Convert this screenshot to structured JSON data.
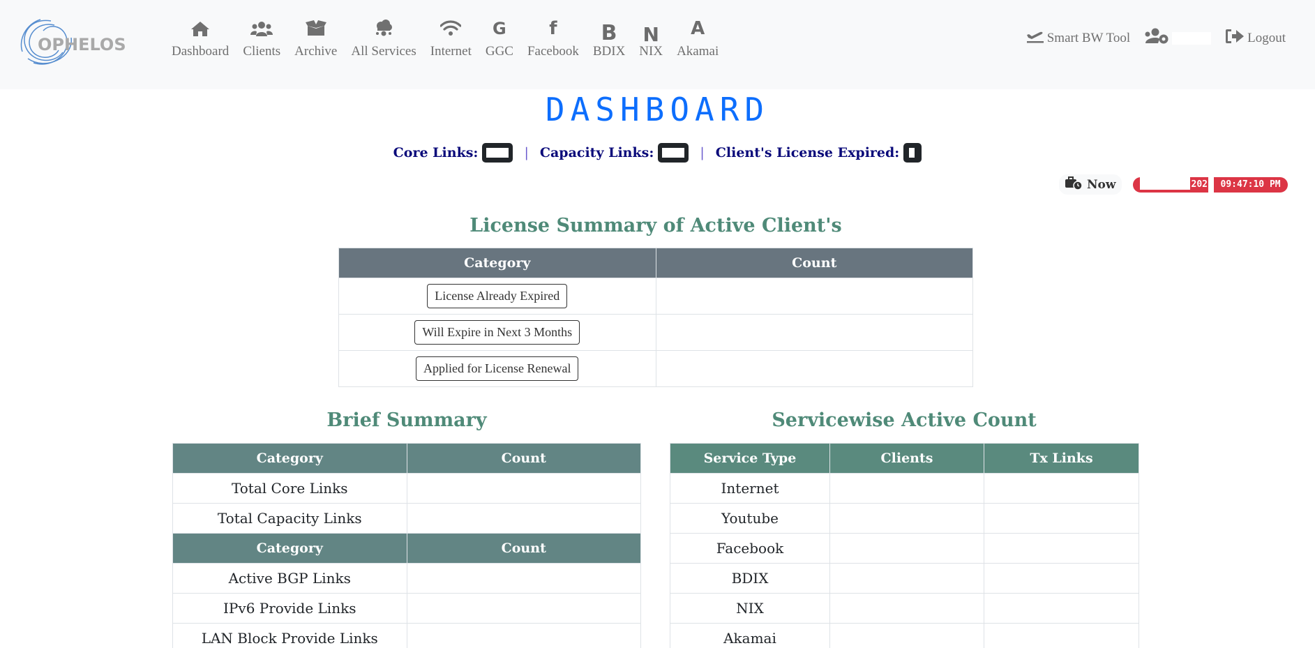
{
  "navbar": {
    "logo_text": "OPHELOS",
    "items": [
      {
        "label": "Dashboard",
        "icon": "home-icon"
      },
      {
        "label": "Clients",
        "icon": "users-icon"
      },
      {
        "label": "Archive",
        "icon": "box-open-icon"
      },
      {
        "label": "All Services",
        "icon": "cloud-network-icon"
      },
      {
        "label": "Internet",
        "icon": "wifi-icon"
      },
      {
        "label": "GGC",
        "icon": "google-icon",
        "glyph": "G"
      },
      {
        "label": "Facebook",
        "icon": "facebook-icon",
        "glyph": "f"
      },
      {
        "label": "BDIX",
        "icon": "bdix-icon",
        "glyph": "B"
      },
      {
        "label": "NIX",
        "icon": "nix-icon",
        "glyph": "N"
      },
      {
        "label": "Akamai",
        "icon": "akamai-icon",
        "glyph": "A"
      }
    ],
    "right": {
      "smart_bw_tool": "Smart BW Tool",
      "logout": "Logout"
    }
  },
  "page_title": "DASHBOARD",
  "summary_line": {
    "core_links_label": "Core Links:",
    "capacity_links_label": "Capacity Links:",
    "license_expired_label": "Client's License Expired:",
    "separator": "|"
  },
  "clock": {
    "now_label": "Now",
    "date_visible": "202",
    "time": "09:47:10 PM"
  },
  "license_summary": {
    "title": "License Summary of Active Client's",
    "headers": [
      "Category",
      "Count"
    ],
    "rows": [
      {
        "category": "License Already Expired",
        "count": ""
      },
      {
        "category": "Will Expire in Next 3 Months",
        "count": ""
      },
      {
        "category": "Applied for License Renewal",
        "count": ""
      }
    ]
  },
  "brief_summary": {
    "title": "Brief Summary",
    "headers": [
      "Category",
      "Count"
    ],
    "rows_a": [
      {
        "category": "Total Core Links",
        "count": ""
      },
      {
        "category": "Total Capacity Links",
        "count": ""
      }
    ],
    "rows_b": [
      {
        "category": "Active BGP Links",
        "count": ""
      },
      {
        "category": "IPv6 Provide Links",
        "count": ""
      },
      {
        "category": "LAN Block Provide Links",
        "count": ""
      }
    ]
  },
  "servicewise": {
    "title": "Servicewise Active Count",
    "headers": [
      "Service Type",
      "Clients",
      "Tx Links"
    ],
    "rows": [
      {
        "service": "Internet",
        "clients": "",
        "tx_links": ""
      },
      {
        "service": "Youtube",
        "clients": "",
        "tx_links": ""
      },
      {
        "service": "Facebook",
        "clients": "",
        "tx_links": ""
      },
      {
        "service": "BDIX",
        "clients": "",
        "tx_links": ""
      },
      {
        "service": "NIX",
        "clients": "",
        "tx_links": ""
      },
      {
        "service": "Akamai",
        "clients": "",
        "tx_links": ""
      }
    ]
  },
  "colors": {
    "title_blue": "#0d6efd",
    "section_green": "#4f8a78",
    "license_header": "#68757f",
    "brief_header": "#628584",
    "service_header": "#5a8a7e",
    "clock_red": "#dc3545",
    "link_navy": "#0a0a7a"
  }
}
